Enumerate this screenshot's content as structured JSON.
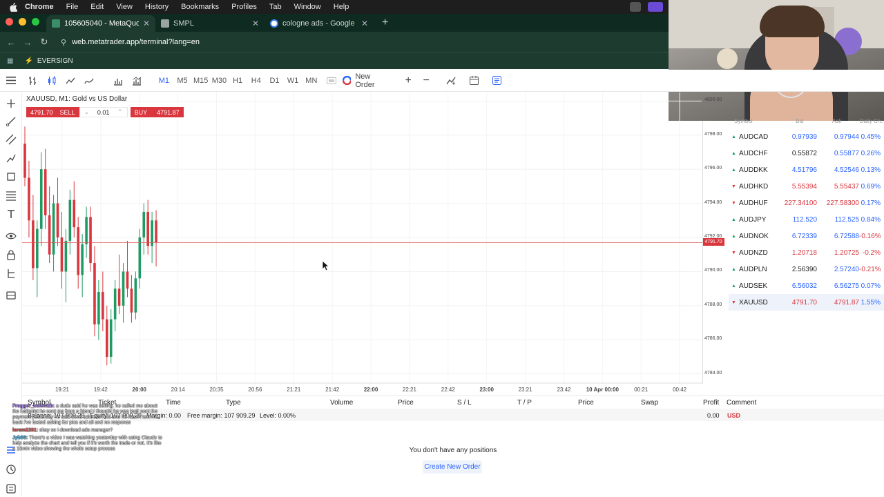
{
  "menubar": {
    "app_name": "Chrome",
    "items": [
      "File",
      "Edit",
      "View",
      "History",
      "Bookmarks",
      "Profiles",
      "Tab",
      "Window",
      "Help"
    ]
  },
  "tabs": [
    {
      "title": "105605040 - MetaQuotes-De",
      "icon": "metatrader-favicon",
      "active": true
    },
    {
      "title": "SMPL",
      "icon": "smpl-favicon",
      "active": false
    },
    {
      "title": "cologne ads - Google Search",
      "icon": "google-favicon",
      "active": false
    }
  ],
  "address": {
    "url": "web.metatrader.app/terminal?lang=en"
  },
  "bookmarks": [
    {
      "label": "EVERSIGN",
      "icon": "lightning-icon"
    }
  ],
  "toolbar": {
    "timeframes": [
      "M1",
      "M5",
      "M15",
      "M30",
      "H1",
      "H4",
      "D1",
      "W1",
      "MN"
    ],
    "active_timeframe": "M1",
    "new_order_label": "New Order"
  },
  "chart": {
    "symbol_title": "XAUUSD, M1: Gold vs US Dollar",
    "sell_price": "4791.70",
    "sell_label": "SELL",
    "volume": "0.01",
    "buy_label": "BUY",
    "buy_price": "4791.87",
    "current_price_label": "4791.70",
    "price_ticks": [
      "4800.00",
      "4798.00",
      "4796.00",
      "4794.00",
      "4792.00",
      "4790.00",
      "4788.00",
      "4786.00",
      "4784.00"
    ],
    "time_ticks": [
      {
        "label": "19:21",
        "bold": false
      },
      {
        "label": "19:42",
        "bold": false
      },
      {
        "label": "20:00",
        "bold": true
      },
      {
        "label": "20:14",
        "bold": false
      },
      {
        "label": "20:35",
        "bold": false
      },
      {
        "label": "20:56",
        "bold": false
      },
      {
        "label": "21:21",
        "bold": false
      },
      {
        "label": "21:42",
        "bold": false
      },
      {
        "label": "22:00",
        "bold": true
      },
      {
        "label": "22:21",
        "bold": false
      },
      {
        "label": "22:42",
        "bold": false
      },
      {
        "label": "23:00",
        "bold": true
      },
      {
        "label": "23:21",
        "bold": false
      },
      {
        "label": "23:42",
        "bold": false
      },
      {
        "label": "10 Apr 00:00",
        "bold": true
      },
      {
        "label": "00:21",
        "bold": false
      },
      {
        "label": "00:42",
        "bold": false
      }
    ],
    "colors": {
      "up": "#1e9b63",
      "down": "#d9363e",
      "price_line": "#e05050"
    }
  },
  "chart_data": {
    "type": "candlestick",
    "title": "XAUUSD, M1: Gold vs US Dollar",
    "ylim": [
      4783.5,
      4800.5
    ],
    "last_price": 4791.7,
    "description_note_free": true,
    "candles": [
      [
        4797.5,
        4798.5,
        4795.0,
        4795.5
      ],
      [
        4795.5,
        4796.5,
        4792.0,
        4793.0
      ],
      [
        4793.0,
        4794.5,
        4789.5,
        4790.2
      ],
      [
        4790.2,
        4793.0,
        4788.5,
        4792.5
      ],
      [
        4792.5,
        4797.0,
        4791.5,
        4796.0
      ],
      [
        4796.0,
        4797.2,
        4792.5,
        4793.3
      ],
      [
        4793.3,
        4795.0,
        4790.5,
        4791.0
      ],
      [
        4791.0,
        4794.5,
        4790.0,
        4794.0
      ],
      [
        4794.0,
        4795.5,
        4791.5,
        4792.0
      ],
      [
        4792.0,
        4793.5,
        4789.0,
        4790.0
      ],
      [
        4790.0,
        4792.5,
        4788.2,
        4791.8
      ],
      [
        4791.8,
        4794.8,
        4791.0,
        4794.2
      ],
      [
        4794.2,
        4795.3,
        4792.0,
        4792.6
      ],
      [
        4792.6,
        4793.2,
        4789.0,
        4789.8
      ],
      [
        4789.8,
        4792.2,
        4788.5,
        4791.6
      ],
      [
        4791.6,
        4793.8,
        4790.8,
        4793.2
      ],
      [
        4793.2,
        4793.8,
        4790.0,
        4790.5
      ],
      [
        4790.5,
        4791.5,
        4786.2,
        4786.9
      ],
      [
        4786.9,
        4789.5,
        4786.0,
        4788.8
      ],
      [
        4788.8,
        4790.0,
        4786.5,
        4787.2
      ],
      [
        4787.2,
        4788.0,
        4784.5,
        4785.0
      ],
      [
        4785.0,
        4787.8,
        4784.6,
        4787.2
      ],
      [
        4787.2,
        4789.5,
        4786.5,
        4789.0
      ],
      [
        4789.0,
        4791.0,
        4787.5,
        4788.0
      ],
      [
        4788.0,
        4790.5,
        4787.0,
        4790.0
      ],
      [
        4790.0,
        4791.8,
        4788.5,
        4789.0
      ],
      [
        4789.0,
        4789.8,
        4787.0,
        4787.6
      ],
      [
        4787.6,
        4790.0,
        4787.2,
        4789.6
      ],
      [
        4789.6,
        4792.5,
        4789.0,
        4792.0
      ],
      [
        4792.0,
        4794.0,
        4791.0,
        4793.5
      ],
      [
        4793.5,
        4794.2,
        4791.0,
        4791.5
      ],
      [
        4791.5,
        4793.5,
        4790.5,
        4793.0
      ],
      [
        4793.0,
        4793.6,
        4790.3,
        4791.7
      ]
    ]
  },
  "market_watch": {
    "headers": {
      "symbol": "Symbol",
      "bid": "Bid",
      "ask": "Ask",
      "change": "Daily Ch..."
    },
    "rows": [
      {
        "symbol": "AUDCAD",
        "bid": "0.97939",
        "ask": "0.97944",
        "change": "0.45%",
        "dir": "up",
        "bid_color": "blue",
        "ask_color": "blue",
        "change_color": "blue",
        "highlight": false
      },
      {
        "symbol": "AUDCHF",
        "bid": "0.55872",
        "ask": "0.55877",
        "change": "0.26%",
        "dir": "up",
        "bid_color": "black",
        "ask_color": "blue",
        "change_color": "blue",
        "highlight": false
      },
      {
        "symbol": "AUDDKK",
        "bid": "4.51796",
        "ask": "4.52546",
        "change": "0.13%",
        "dir": "up",
        "bid_color": "blue",
        "ask_color": "blue",
        "change_color": "blue",
        "highlight": false
      },
      {
        "symbol": "AUDHKD",
        "bid": "5.55394",
        "ask": "5.55437",
        "change": "0.69%",
        "dir": "down",
        "bid_color": "red",
        "ask_color": "red",
        "change_color": "blue",
        "highlight": false
      },
      {
        "symbol": "AUDHUF",
        "bid": "227.34100",
        "ask": "227.58300",
        "change": "0.17%",
        "dir": "down",
        "bid_color": "red",
        "ask_color": "red",
        "change_color": "blue",
        "highlight": false
      },
      {
        "symbol": "AUDJPY",
        "bid": "112.520",
        "ask": "112.525",
        "change": "0.84%",
        "dir": "up",
        "bid_color": "blue",
        "ask_color": "blue",
        "change_color": "blue",
        "highlight": false
      },
      {
        "symbol": "AUDNOK",
        "bid": "6.72339",
        "ask": "6.72588",
        "change": "-0.16%",
        "dir": "up",
        "bid_color": "blue",
        "ask_color": "blue",
        "change_color": "red",
        "highlight": false
      },
      {
        "symbol": "AUDNZD",
        "bid": "1.20718",
        "ask": "1.20725",
        "change": "-0.2%",
        "dir": "down",
        "bid_color": "red",
        "ask_color": "red",
        "change_color": "red",
        "highlight": false
      },
      {
        "symbol": "AUDPLN",
        "bid": "2.56390",
        "ask": "2.57240",
        "change": "-0.21%",
        "dir": "up",
        "bid_color": "black",
        "ask_color": "blue",
        "change_color": "red",
        "highlight": false
      },
      {
        "symbol": "AUDSEK",
        "bid": "6.56032",
        "ask": "6.56275",
        "change": "0.07%",
        "dir": "up",
        "bid_color": "blue",
        "ask_color": "blue",
        "change_color": "blue",
        "highlight": false
      },
      {
        "symbol": "XAUUSD",
        "bid": "4791.70",
        "ask": "4791.87",
        "change": "1.55%",
        "dir": "down",
        "bid_color": "red",
        "ask_color": "red",
        "change_color": "blue",
        "highlight": true
      }
    ]
  },
  "positions": {
    "headers": [
      "Symbol",
      "Ticket",
      "Time",
      "Type",
      "Volume",
      "Price",
      "S / L",
      "T / P",
      "Price",
      "Swap",
      "Profit",
      "Comment"
    ],
    "balance_text": "Balance: 107 909.29",
    "equity_text": "Equity: 107 909.29",
    "margin_text": "Margin: 0.00",
    "free_margin_text": "Free margin: 107 909.29",
    "level_text": "Level: 0.00%",
    "profit_value": "0.00",
    "currency": "USD",
    "empty_message": "You don't have any positions",
    "create_button": "Create New Order"
  },
  "chat": [
    {
      "user": "Frogger_boiemzb:",
      "text": "a dude said he was selling. he called me aboutt the ballpoint he sent me from a friend i thought he was legit sent the payment yesterday he said send address i did and he hasn't text me back i've texted asking for pics and all and no response",
      "color": "u1"
    },
    {
      "user": "lorem2201:",
      "text": "okay so i download ads manager?",
      "color": "u2"
    },
    {
      "user": "Jyb00:",
      "text": "There's a video I was watching yesterday with using Claude to help analyze the chart and tell you if it's worth the trade or not. It's like a 10min video showing the whole setup process",
      "color": "u3"
    }
  ]
}
